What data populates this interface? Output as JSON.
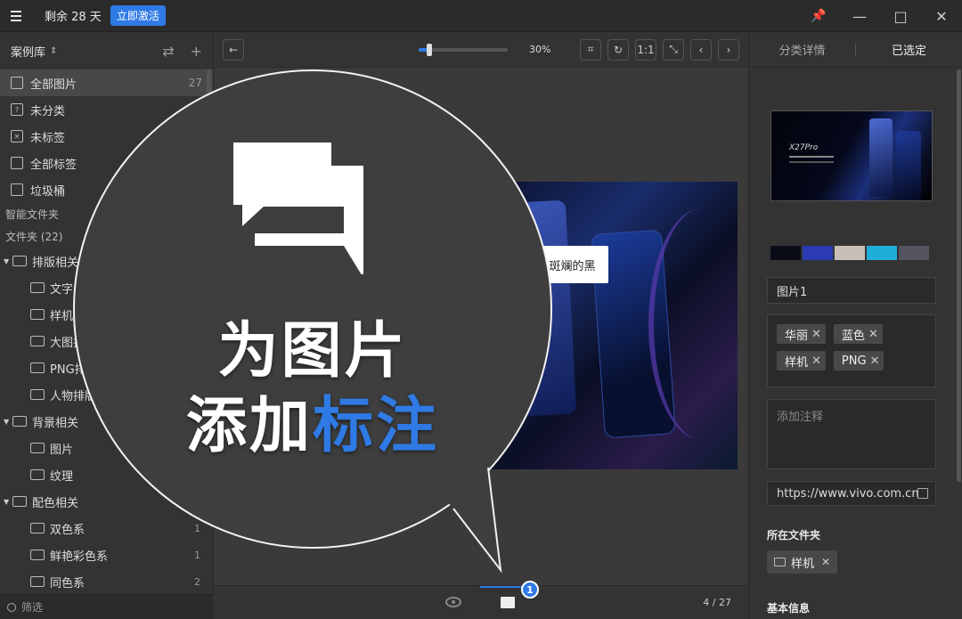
{
  "titlebar": {
    "trial": "剩余 28 天",
    "activate": "立即激活"
  },
  "sidebar": {
    "library": "案例库",
    "nav": [
      {
        "label": "全部图片",
        "count": "27",
        "active": true
      },
      {
        "label": "未分类"
      },
      {
        "label": "未标签"
      },
      {
        "label": "全部标签"
      },
      {
        "label": "垃圾桶"
      }
    ],
    "smart_folders": "智能文件夹",
    "folders_label": "文件夹 (22)",
    "folders": [
      {
        "label": "排版相关"
      },
      {
        "label": "文字"
      },
      {
        "label": "样机"
      },
      {
        "label": "大图排"
      },
      {
        "label": "PNG排"
      },
      {
        "label": "人物排版"
      },
      {
        "label": "背景相关"
      },
      {
        "label": "图片"
      },
      {
        "label": "纹理"
      },
      {
        "label": "配色相关"
      },
      {
        "label": "双色系",
        "count": "1"
      },
      {
        "label": "鲜艳彩色系",
        "count": "1"
      },
      {
        "label": "同色系",
        "count": "2"
      }
    ],
    "filter_placeholder": "筛选"
  },
  "viewer": {
    "zoom": "30%",
    "zoom_value": 0.3,
    "annotation_text": "斑斓的黑",
    "page": "4 / 27",
    "badge": "1",
    "btn_reset": "1:1"
  },
  "right": {
    "tab_details": "分类详情",
    "tab_selected": "已选定",
    "thumb_title": "X27Pro",
    "palette": [
      "#0a0d18",
      "#2a3bb3",
      "#c8c0b8",
      "#1faed8",
      "#545460"
    ],
    "name": "图片1",
    "tags": [
      "华丽",
      "蓝色",
      "样机",
      "PNG"
    ],
    "note_placeholder": "添加注释",
    "url": "https://www.vivo.com.cn",
    "folder_label": "所在文件夹",
    "folder": "样机",
    "basic_info": "基本信息"
  },
  "overlay": {
    "line1": "为图片",
    "line2_a": "添加",
    "line2_b": "标注"
  },
  "colors": {
    "accent": "#2f7ae5"
  }
}
